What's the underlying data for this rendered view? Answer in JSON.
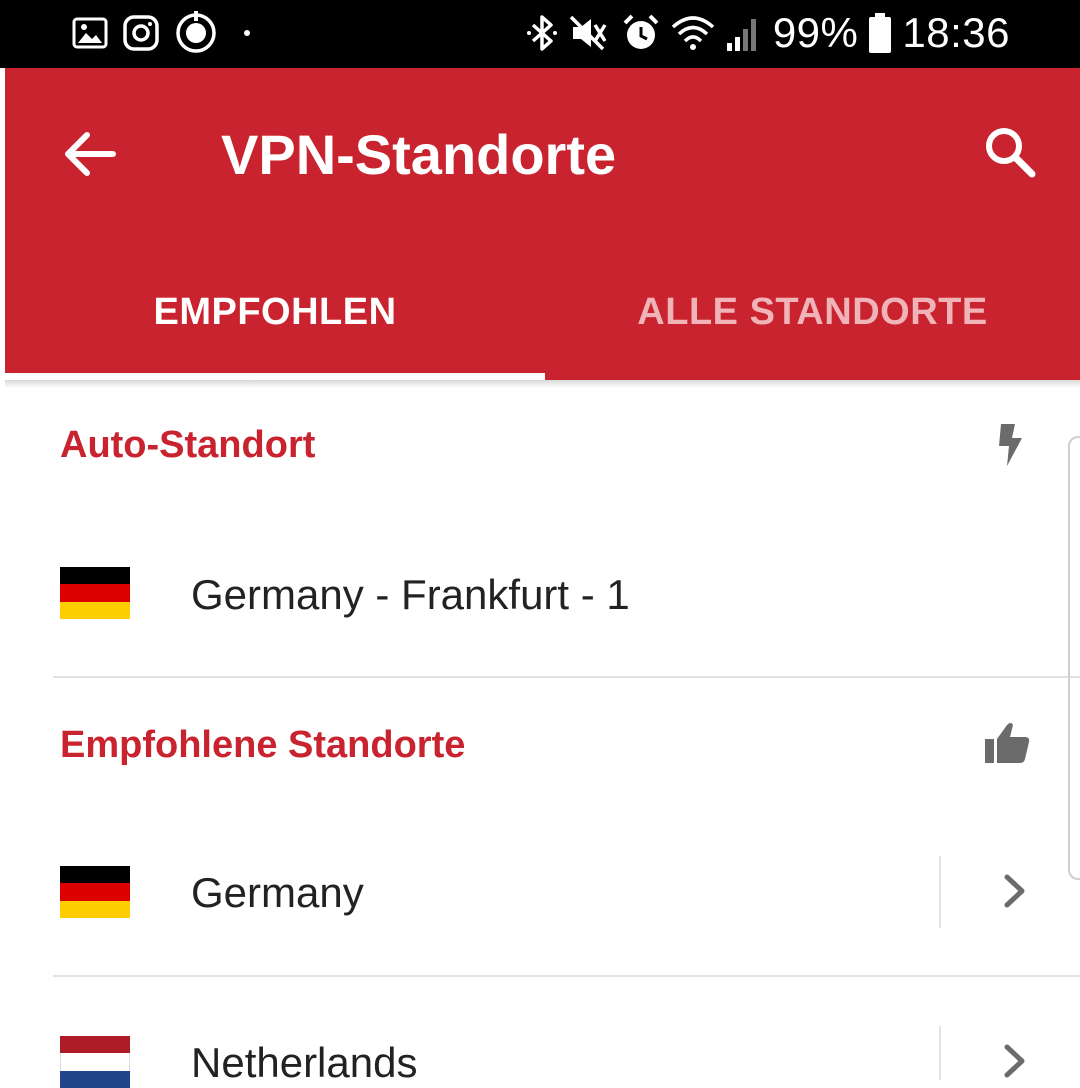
{
  "status_bar": {
    "time": "18:36",
    "battery_percent": "99%",
    "icons_left": [
      "image-icon",
      "instagram-icon",
      "target-icon",
      "dot-icon"
    ],
    "icons_right": [
      "bluetooth-icon",
      "mute-icon",
      "alarm-icon",
      "wifi-icon",
      "signal-icon",
      "battery-icon"
    ]
  },
  "app_bar": {
    "title": "VPN-Standorte",
    "back_icon": "arrow-left-icon",
    "search_icon": "search-icon",
    "background_color": "#c8232e"
  },
  "tabs": [
    {
      "label": "EMPFOHLEN",
      "selected": true
    },
    {
      "label": "ALLE STANDORTE",
      "selected": false
    }
  ],
  "sections": [
    {
      "title": "Auto-Standort",
      "icon": "lightning-bolt-icon",
      "items": [
        {
          "label": "Germany - Frankfurt - 1",
          "flag": "germany-flag-icon",
          "has_chevron": false
        }
      ]
    },
    {
      "title": "Empfohlene Standorte",
      "icon": "thumbs-up-icon",
      "items": [
        {
          "label": "Germany",
          "flag": "germany-flag-icon",
          "has_chevron": true
        },
        {
          "label": "Netherlands",
          "flag": "netherlands-flag-icon",
          "has_chevron": true
        }
      ]
    }
  ],
  "colors": {
    "accent": "#c8232e",
    "tab_inactive": "#f0b4b8",
    "text_primary": "#222222",
    "icon_gray": "#6b6b6b"
  }
}
